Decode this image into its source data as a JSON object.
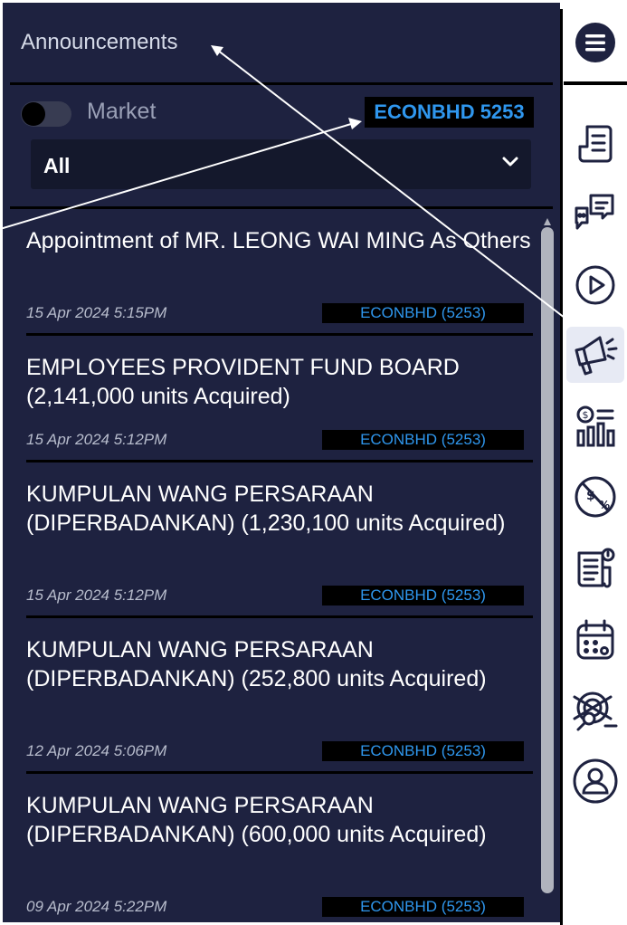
{
  "panel": {
    "title": "Announcements"
  },
  "filter_bar": {
    "toggle_label": "Market",
    "toggle_on": false,
    "ticker_tag": "ECONBHD 5253",
    "select_value": "All"
  },
  "announcements": [
    {
      "title": "Appointment of MR. LEONG WAI MING As Others",
      "date": "15 Apr 2024  5:15PM",
      "code": "ECONBHD (5253)"
    },
    {
      "title": "EMPLOYEES PROVIDENT FUND BOARD (2,141,000 units Acquired)",
      "date": "15 Apr 2024  5:12PM",
      "code": "ECONBHD (5253)"
    },
    {
      "title": "KUMPULAN WANG PERSARAAN (DIPERBADANKAN) (1,230,100 units Acquired)",
      "date": "15 Apr 2024  5:12PM",
      "code": "ECONBHD (5253)"
    },
    {
      "title": "KUMPULAN WANG PERSARAAN (DIPERBADANKAN) (252,800 units Acquired)",
      "date": "12 Apr 2024  5:06PM",
      "code": "ECONBHD (5253)"
    },
    {
      "title": "KUMPULAN WANG PERSARAAN (DIPERBADANKAN) (600,000 units Acquired)",
      "date": "09 Apr 2024  5:22PM",
      "code": "ECONBHD (5253)"
    }
  ],
  "sidebar": {
    "icons": [
      "menu-icon",
      "document-icon",
      "chat-icon",
      "play-icon",
      "megaphone-icon",
      "dividend-chart-icon",
      "discount-icon",
      "news-icon",
      "calendar-icon",
      "radar-icon",
      "user-icon"
    ],
    "active": "megaphone-icon"
  },
  "colors": {
    "panel_bg": "#1e2240",
    "accent": "#2f97ee",
    "text": "#ffffff"
  }
}
